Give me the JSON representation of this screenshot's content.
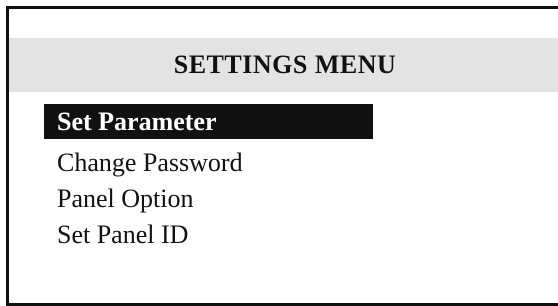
{
  "header": {
    "title": "SETTINGS MENU"
  },
  "menu": {
    "items": [
      {
        "label": "Set Parameter",
        "selected": true
      },
      {
        "label": "Change Password",
        "selected": false
      },
      {
        "label": "Panel Option",
        "selected": false
      },
      {
        "label": "Set Panel ID",
        "selected": false
      }
    ]
  },
  "colors": {
    "selection_background": "#111111",
    "selection_text": "#ffffff",
    "title_bar": "#e3e3e3",
    "text": "#111111"
  }
}
